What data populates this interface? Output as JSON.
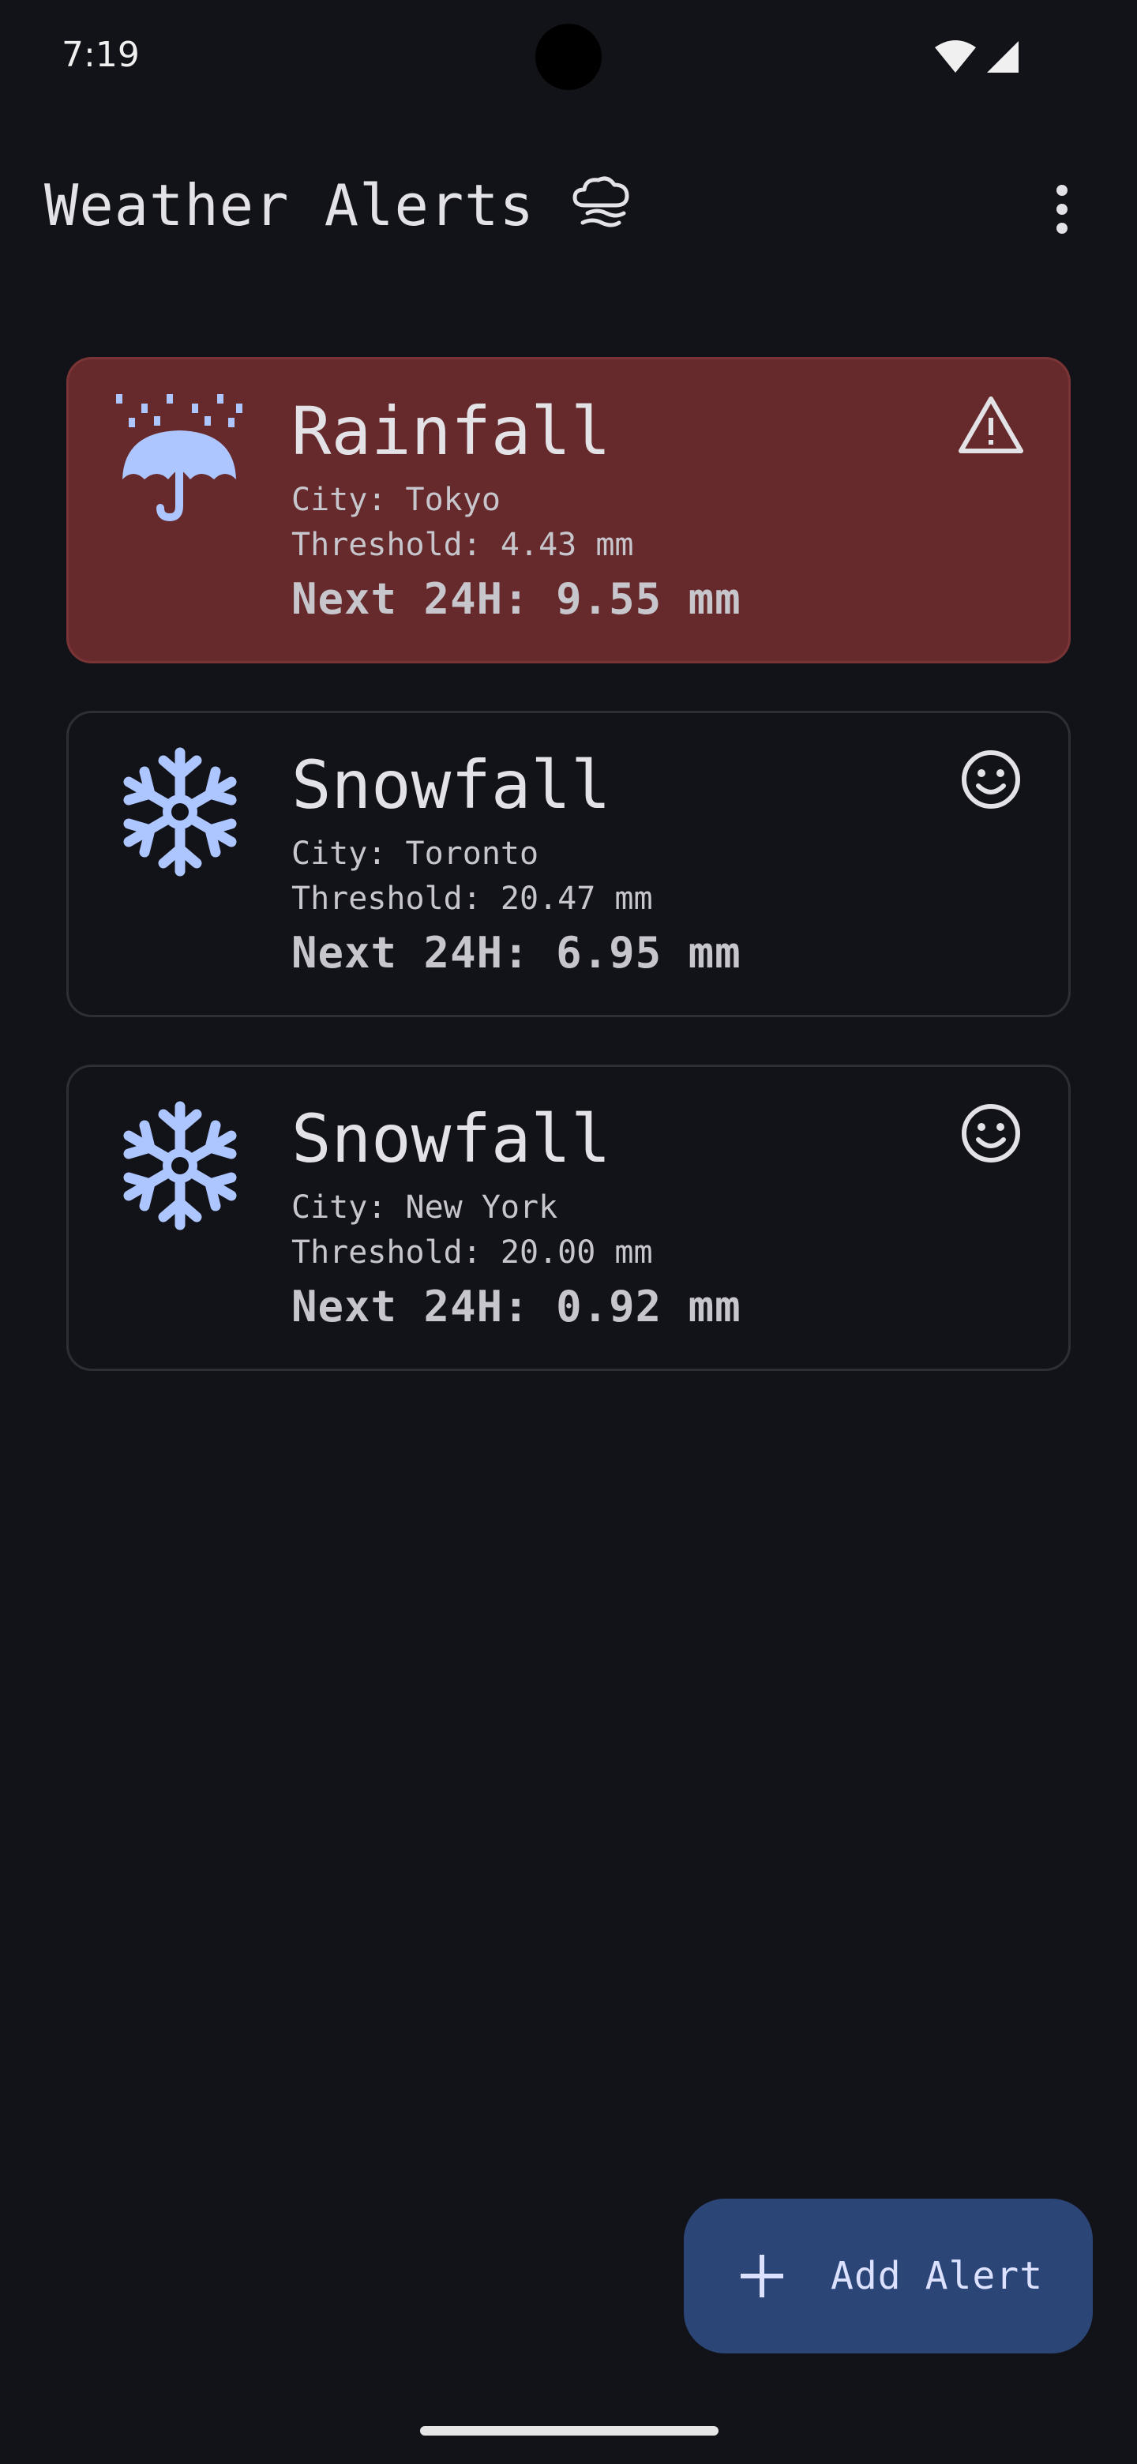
{
  "status_bar": {
    "time": "7:19"
  },
  "app_bar": {
    "title": "Weather Alerts",
    "title_icon": "storm-cloud-icon",
    "menu_icon": "more-vert-icon"
  },
  "alerts": [
    {
      "type": "Rainfall",
      "city": "City: Tokyo",
      "threshold": "Threshold: 4.43 mm",
      "next": "Next 24H: 9.55 mm",
      "icon": "umbrella-rain-icon",
      "status_icon": "warning-icon",
      "triggered": true
    },
    {
      "type": "Snowfall",
      "city": "City: Toronto",
      "threshold": "Threshold: 20.47 mm",
      "next": "Next 24H: 6.95 mm",
      "icon": "snowflake-icon",
      "status_icon": "smiley-icon",
      "triggered": false
    },
    {
      "type": "Snowfall",
      "city": "City: New York",
      "threshold": "Threshold: 20.00 mm",
      "next": "Next 24H: 0.92 mm",
      "icon": "snowflake-icon",
      "status_icon": "smiley-icon",
      "triggered": false
    }
  ],
  "fab": {
    "label": "Add Alert",
    "icon": "plus-icon"
  },
  "colors": {
    "background": "#121318",
    "triggered_card": "#662a2c",
    "icon_accent": "#aec6ff",
    "fab": "#2c4577"
  }
}
